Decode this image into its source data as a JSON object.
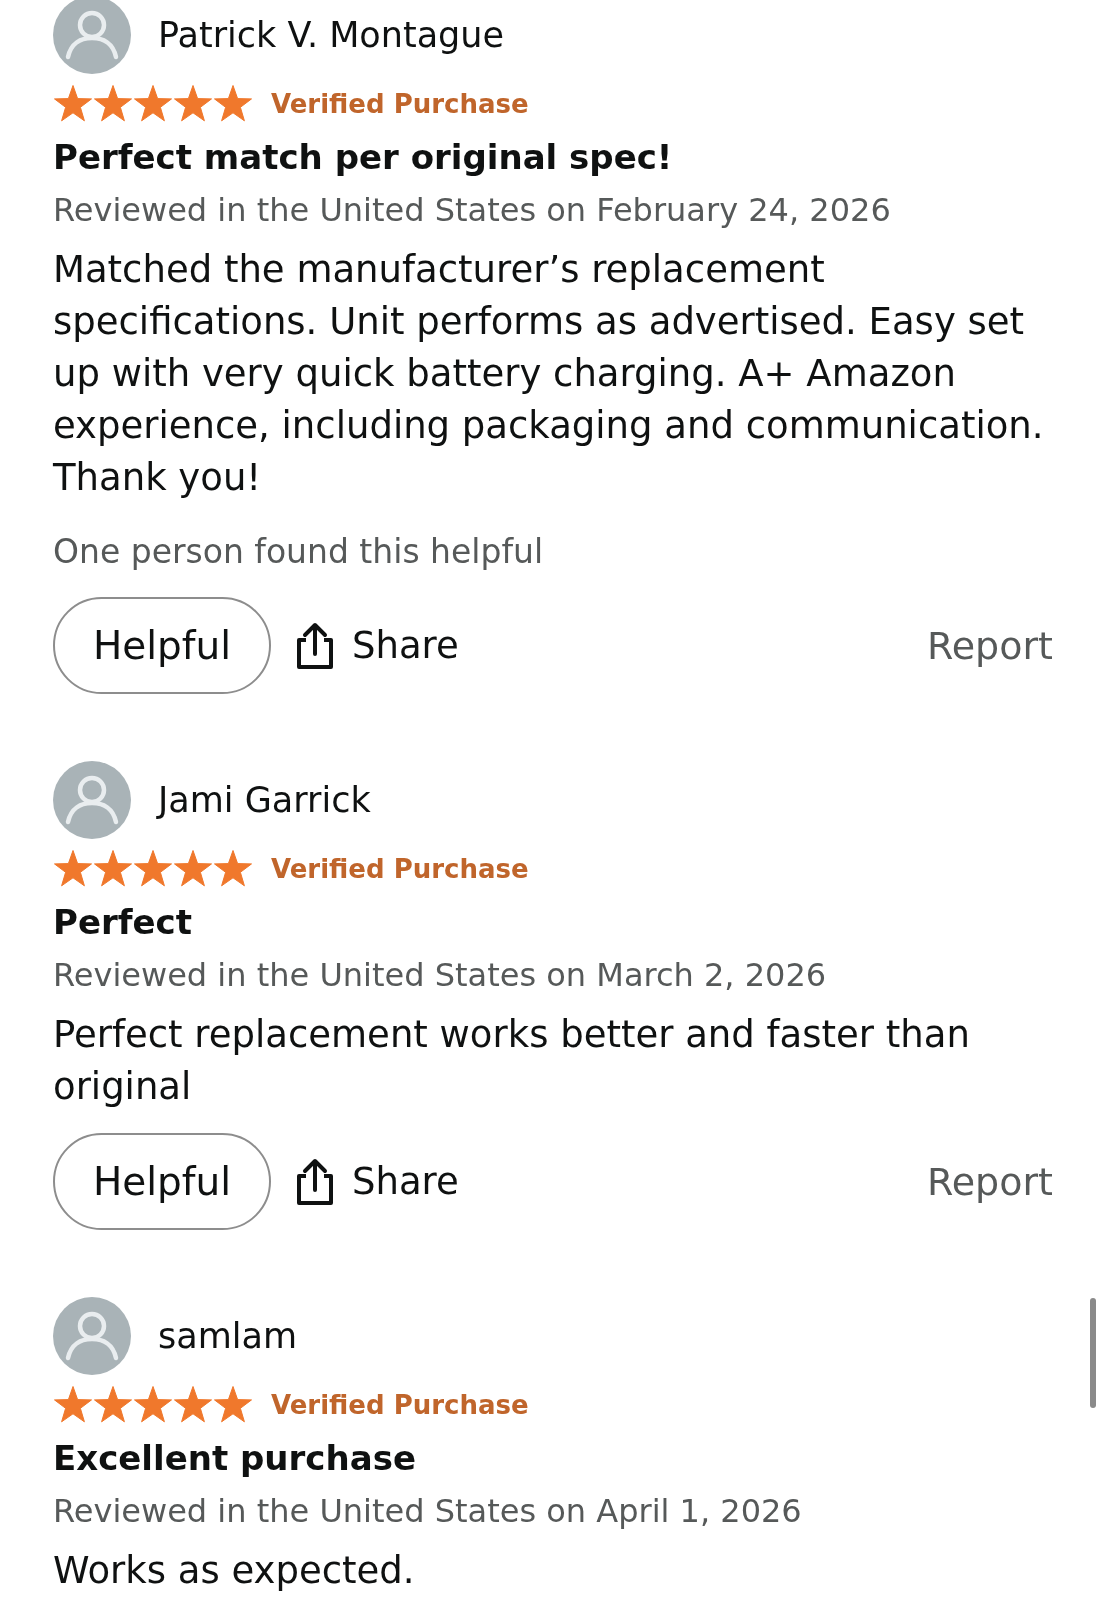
{
  "reviews": [
    {
      "reviewer": "Patrick V. Montague",
      "stars": 5,
      "verified": "Verified Purchase",
      "title": "Perfect match per original spec!",
      "date": "Reviewed in the United States on February 24, 2026",
      "body": "Matched the manufacturer’s replacement specifications. Unit performs as advertised. Easy set up with very quick battery charging. A+ Amazon experience, including packaging and communication. Thank you!",
      "helpful_count": "One person found this helpful",
      "actions": {
        "helpful": "Helpful",
        "share": "Share",
        "report": "Report"
      }
    },
    {
      "reviewer": "Jami Garrick",
      "stars": 5,
      "verified": "Verified Purchase",
      "title": "Perfect",
      "date": "Reviewed in the United States on March 2, 2026",
      "body": "Perfect replacement works better and faster than original",
      "actions": {
        "helpful": "Helpful",
        "share": "Share",
        "report": "Report"
      }
    },
    {
      "reviewer": "samlam",
      "stars": 5,
      "verified": "Verified Purchase",
      "title": "Excellent purchase",
      "date": "Reviewed in the United States on April 1, 2026",
      "body": "Works as expected."
    }
  ]
}
